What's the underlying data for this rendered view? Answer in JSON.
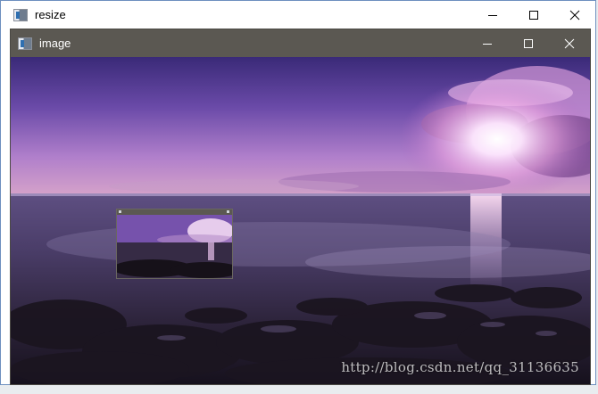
{
  "outer_window": {
    "title": "resize",
    "border_color": "#6d8fbf",
    "titlebar_color": "#ffffff"
  },
  "inner_window": {
    "title": "image",
    "titlebar_color": "#5b5852"
  },
  "icons": {
    "minimize": "minimize-icon",
    "maximize": "maximize-icon",
    "close": "close-icon",
    "app": "app-icon"
  },
  "image": {
    "subject": "purple sunset over rocky sea shore",
    "watermark": "http://blog.csdn.net/qq_31136635"
  }
}
